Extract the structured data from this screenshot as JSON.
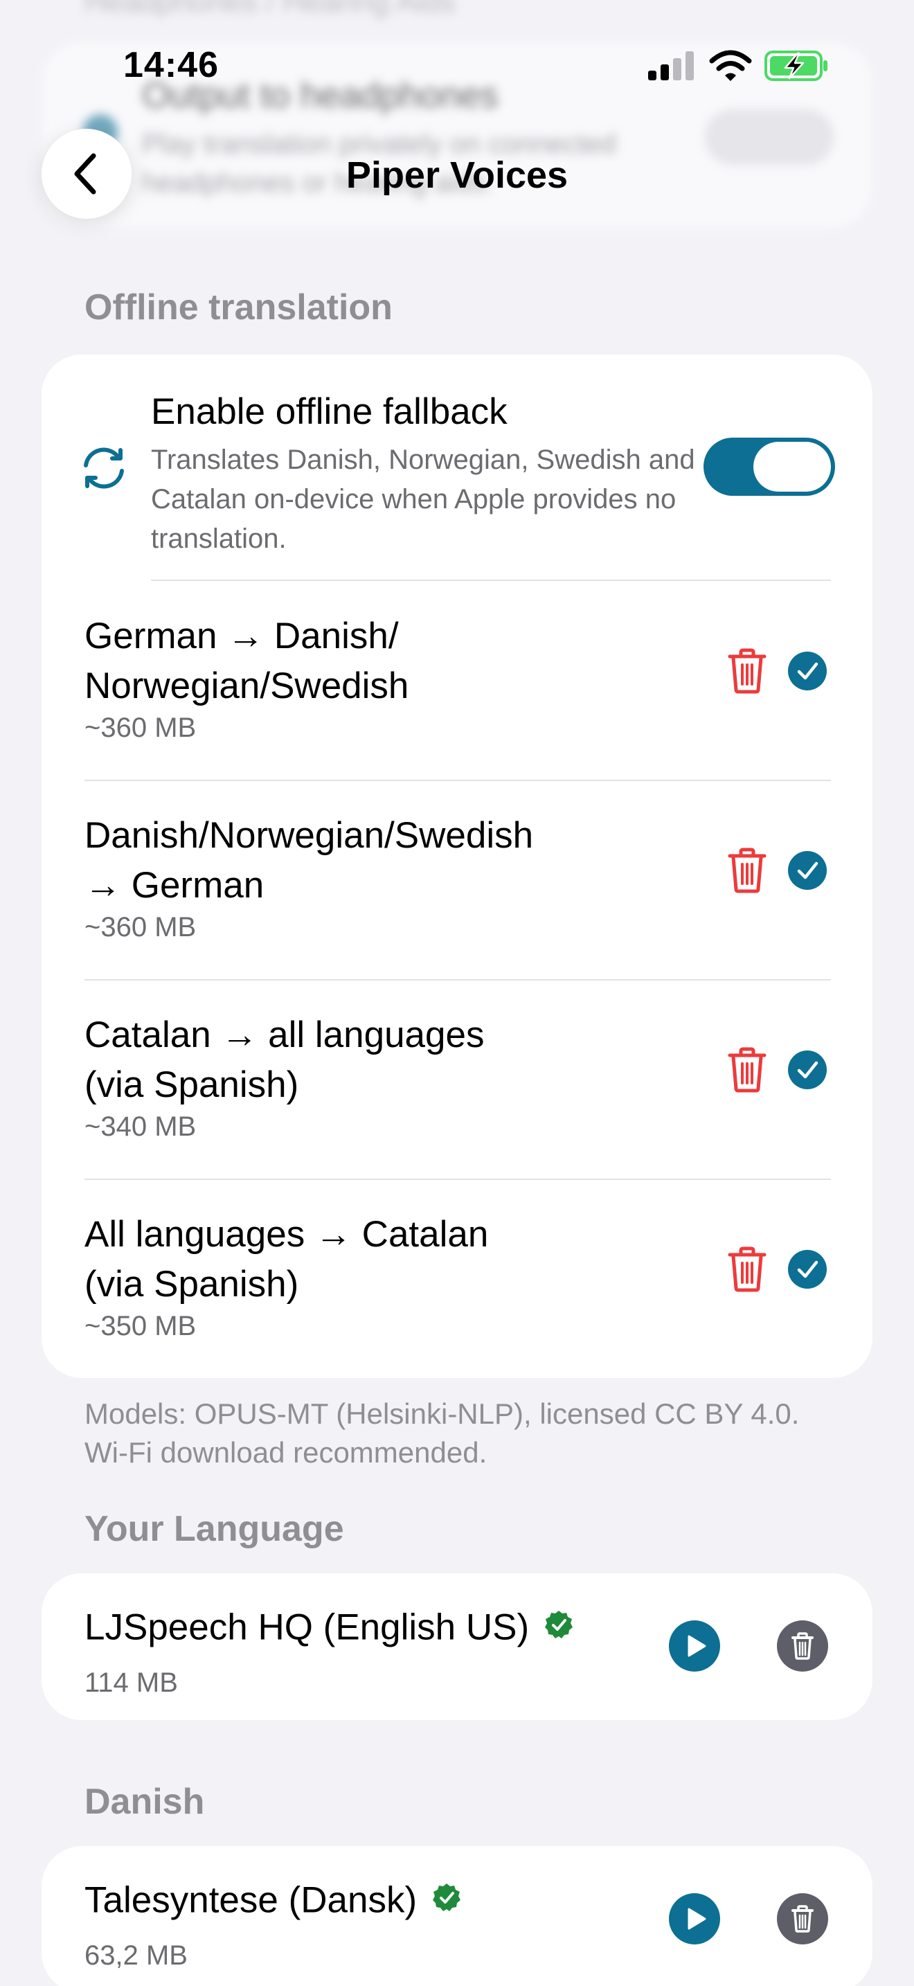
{
  "ghost": {
    "header": "Headphones / Hearing Aids",
    "title": "Output to headphones",
    "subtitle": "Play translation privately on connected headphones or hearing aids."
  },
  "status": {
    "time": "14:46"
  },
  "nav": {
    "title": "Piper Voices"
  },
  "offline": {
    "header": "Offline translation",
    "fallback": {
      "title": "Enable offline fallback",
      "description": "Translates Danish, Norwegian, Swedish and Catalan on-device when Apple provides no translation.",
      "enabled": true
    },
    "models": [
      {
        "line1": "German → Danish/",
        "line2": "Norwegian/Swedish",
        "size": "~360 MB",
        "installed": true
      },
      {
        "line1": "Danish/Norwegian/Swedish",
        "line2": "→ German",
        "size": "~360 MB",
        "installed": true
      },
      {
        "line1": "Catalan → all languages",
        "line2": "(via Spanish)",
        "size": "~340 MB",
        "installed": true
      },
      {
        "line1": "All languages → Catalan",
        "line2": "(via Spanish)",
        "size": "~350 MB",
        "installed": true
      }
    ],
    "footnote": "Models: OPUS-MT (Helsinki-NLP), licensed CC BY 4.0. Wi-Fi download recommended."
  },
  "your_language": {
    "header": "Your Language",
    "voice": {
      "name": "LJSpeech HQ (English US)",
      "size": "114 MB",
      "installed": true
    }
  },
  "danish": {
    "header": "Danish",
    "voice": {
      "name": "Talesyntese (Dansk)",
      "size": "63,2 MB",
      "installed": true
    }
  },
  "icons": {
    "back": "chevron-left-icon",
    "fallback": "sync-arrows-icon",
    "delete": "trash-icon",
    "installed": "checkmark-circle-icon",
    "play": "play-circle-icon",
    "verified": "verified-check-icon"
  },
  "colors": {
    "accent": "#0c6f93",
    "destructive": "#ec3b3b",
    "verified": "#1f8a3a",
    "secondary_text": "#6b6b70",
    "section_header": "#8e8e93",
    "background": "#f2f2f7"
  }
}
